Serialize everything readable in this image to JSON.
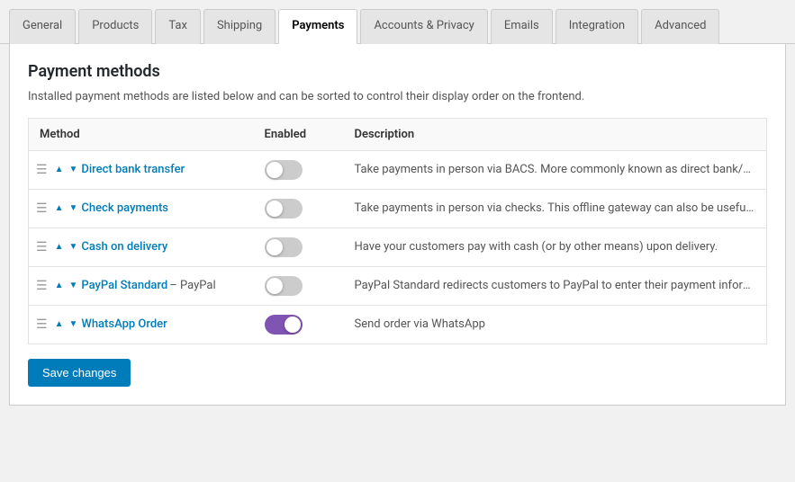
{
  "tabs": [
    {
      "id": "general",
      "label": "General",
      "active": false
    },
    {
      "id": "products",
      "label": "Products",
      "active": false
    },
    {
      "id": "tax",
      "label": "Tax",
      "active": false
    },
    {
      "id": "shipping",
      "label": "Shipping",
      "active": false
    },
    {
      "id": "payments",
      "label": "Payments",
      "active": true
    },
    {
      "id": "accounts-privacy",
      "label": "Accounts & Privacy",
      "active": false
    },
    {
      "id": "emails",
      "label": "Emails",
      "active": false
    },
    {
      "id": "integration",
      "label": "Integration",
      "active": false
    },
    {
      "id": "advanced",
      "label": "Advanced",
      "active": false
    }
  ],
  "page": {
    "title": "Payment methods",
    "description": "Installed payment methods are listed below and can be sorted to control their display order on the frontend."
  },
  "table": {
    "headers": {
      "method": "Method",
      "enabled": "Enabled",
      "description": "Description"
    },
    "rows": [
      {
        "id": "direct-bank-transfer",
        "method_label": "Direct bank transfer",
        "method_subtitle": "",
        "enabled": false,
        "description": "Take payments in person via BACS. More commonly known as direct bank/wire transfer."
      },
      {
        "id": "check-payments",
        "method_label": "Check payments",
        "method_subtitle": "",
        "enabled": false,
        "description": "Take payments in person via checks. This offline gateway can also be useful to test purchases."
      },
      {
        "id": "cash-on-delivery",
        "method_label": "Cash on delivery",
        "method_subtitle": "",
        "enabled": false,
        "description": "Have your customers pay with cash (or by other means) upon delivery."
      },
      {
        "id": "paypal-standard",
        "method_label": "PayPal Standard",
        "method_subtitle": "– PayPal",
        "enabled": false,
        "description": "PayPal Standard redirects customers to PayPal to enter their payment information."
      },
      {
        "id": "whatsapp-order",
        "method_label": "WhatsApp Order",
        "method_subtitle": "",
        "enabled": true,
        "description": "Send order via WhatsApp"
      }
    ]
  },
  "buttons": {
    "save": "Save changes"
  }
}
